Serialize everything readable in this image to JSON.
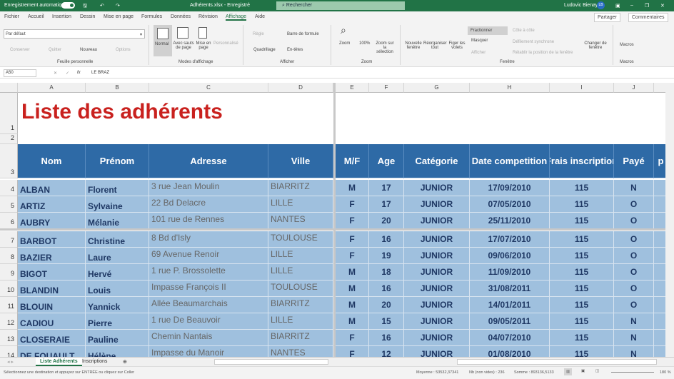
{
  "titlebar": {
    "autosave": "Enregistrement automatique",
    "filename": "Adhérents.xlsx - Enregistré",
    "search": "Rechercher",
    "user": "Ludovic Bienay",
    "initials": "LB"
  },
  "tabs": [
    "Fichier",
    "Accueil",
    "Insertion",
    "Dessin",
    "Mise en page",
    "Formules",
    "Données",
    "Révision",
    "Affichage",
    "Aide"
  ],
  "active_tab": "Affichage",
  "share": "Partager",
  "comments": "Commentaires",
  "ribbon": {
    "view_select": "Par défaut",
    "conserver": "Conserver",
    "quitter": "Quitter",
    "nouveau": "Nouveau",
    "options": "Options",
    "g1": "Feuille personnelle",
    "normal": "Normal",
    "sauts": "Avec sauts de page",
    "mise_en_page": "Mise en page",
    "personnalise": "Personnalisé",
    "g2": "Modes d'affichage",
    "regle": "Règle",
    "barre_formule": "Barre de formule",
    "quadrillage": "Quadrillage",
    "entetes": "En-têtes",
    "g3": "Afficher",
    "zoom": "Zoom",
    "p100": "100%",
    "zoom_sel": "Zoom sur la sélection",
    "g4": "Zoom",
    "nouvelle_fenetre": "Nouvelle fenêtre",
    "reorganiser": "Réorganiser tout",
    "figer": "Figer les volets",
    "fractionner": "Fractionner",
    "masquer": "Masquer",
    "afficher": "Afficher",
    "cote": "Côte à côte",
    "defilement": "Défilement synchrone",
    "retablir": "Rétablir la position de la fenêtre",
    "changer": "Changer de fenêtre",
    "g5": "Fenêtre",
    "macros": "Macros",
    "g6": "Macros"
  },
  "formula": {
    "namebox": "A50",
    "value": "LE BRAZ"
  },
  "columns": [
    "A",
    "B",
    "C",
    "D",
    "E",
    "F",
    "G",
    "H",
    "I",
    "J"
  ],
  "sheet_title": "Liste des adhérents",
  "headers": [
    "Nom",
    "Prénom",
    "Adresse",
    "Ville",
    "M/F",
    "Age",
    "Catégorie",
    "Date competition",
    "Frais inscription",
    "Payé",
    "p"
  ],
  "rows": [
    {
      "n": "4",
      "c": [
        "ALBAN",
        "Florent",
        "3 rue Jean Moulin",
        "BIARRITZ",
        "M",
        "17",
        "JUNIOR",
        "17/09/2010",
        "115",
        "N"
      ]
    },
    {
      "n": "5",
      "c": [
        "ARTIZ",
        "Sylvaine",
        "22 Bd Delacre",
        "LILLE",
        "F",
        "17",
        "JUNIOR",
        "07/05/2010",
        "115",
        "O"
      ]
    },
    {
      "n": "6",
      "c": [
        "AUBRY",
        "Mélanie",
        "101 rue de Rennes",
        "NANTES",
        "F",
        "20",
        "JUNIOR",
        "25/11/2010",
        "115",
        "O"
      ]
    },
    {
      "n": "7",
      "c": [
        "BARBOT",
        "Christine",
        "8 Bd d'Isly",
        "TOULOUSE",
        "F",
        "16",
        "JUNIOR",
        "17/07/2010",
        "115",
        "O"
      ]
    },
    {
      "n": "8",
      "c": [
        "BAZIER",
        "Laure",
        "69 Avenue Renoir",
        "LILLE",
        "F",
        "19",
        "JUNIOR",
        "09/06/2010",
        "115",
        "O"
      ]
    },
    {
      "n": "9",
      "c": [
        "BIGOT",
        "Hervé",
        "1 rue P. Brossolette",
        "LILLE",
        "M",
        "18",
        "JUNIOR",
        "11/09/2010",
        "115",
        "O"
      ]
    },
    {
      "n": "10",
      "c": [
        "BLANDIN",
        "Louis",
        "Impasse François II",
        "TOULOUSE",
        "M",
        "16",
        "JUNIOR",
        "31/08/2011",
        "115",
        "O"
      ]
    },
    {
      "n": "11",
      "c": [
        "BLOUIN",
        "Yannick",
        "Allée Beaumarchais",
        "BIARRITZ",
        "M",
        "20",
        "JUNIOR",
        "14/01/2011",
        "115",
        "O"
      ]
    },
    {
      "n": "12",
      "c": [
        "CADIOU",
        "Pierre",
        "1 rue De Beauvoir",
        "LILLE",
        "M",
        "15",
        "JUNIOR",
        "09/05/2011",
        "115",
        "N"
      ]
    },
    {
      "n": "13",
      "c": [
        "CLOSERAIE",
        "Pauline",
        "Chemin Nantais",
        "BIARRITZ",
        "F",
        "16",
        "JUNIOR",
        "04/07/2010",
        "115",
        "N"
      ]
    },
    {
      "n": "14",
      "c": [
        "DE FOUAULT",
        "Hélène",
        "Impasse du Manoir",
        "NANTES",
        "F",
        "12",
        "JUNIOR",
        "01/08/2010",
        "115",
        "N"
      ]
    }
  ],
  "sheets": [
    "Liste Adhérents",
    "Inscriptions"
  ],
  "status": {
    "message": "Sélectionnez une destination et appuyez sur ENTRÉE ou cliquez sur Coller",
    "moyenne": "Moyenne : 53532,37341",
    "nb": "Nb (non vides) : 236",
    "somme": "Somme : 893136,5133",
    "zoom": "180 %"
  },
  "colors": {
    "brand": "#217346",
    "header_fill": "#2e6aa6",
    "data_fill": "#9fc0de",
    "title": "#c9211e"
  }
}
